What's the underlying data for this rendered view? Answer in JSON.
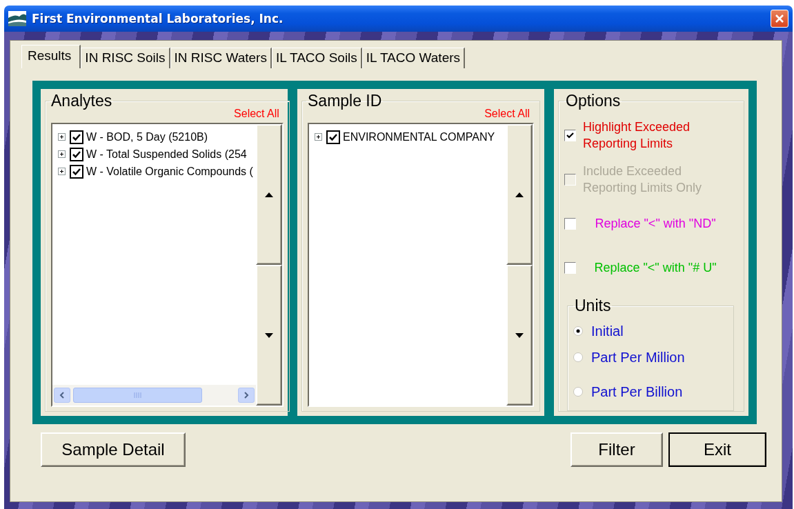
{
  "window": {
    "title": "First Environmental Laboratories, Inc."
  },
  "tabs": [
    {
      "label": "Results",
      "selected": true
    },
    {
      "label": "IN RISC Soils",
      "selected": false
    },
    {
      "label": "IN RISC Waters",
      "selected": false
    },
    {
      "label": "IL TACO Soils",
      "selected": false
    },
    {
      "label": "IL TACO Waters",
      "selected": false
    }
  ],
  "analytes": {
    "title": "Analytes",
    "select_all": "Select All",
    "items": [
      {
        "label": "W - BOD, 5 Day (5210B)",
        "checked": true,
        "expanded": false
      },
      {
        "label": "W - Total Suspended Solids (254",
        "checked": true,
        "expanded": false
      },
      {
        "label": "W - Volatile Organic Compounds (",
        "checked": true,
        "expanded": false
      }
    ]
  },
  "sample_id": {
    "title": "Sample ID",
    "select_all": "Select All",
    "items": [
      {
        "label": "ENVIRONMENTAL COMPANY",
        "checked": true,
        "expanded": false
      }
    ]
  },
  "options": {
    "title": "Options",
    "checkboxes": [
      {
        "label": "Highlight Exceeded Reporting Limits",
        "checked": true,
        "disabled": false,
        "color": "#e00000"
      },
      {
        "label": "Include Exceeded Reporting Limits Only",
        "checked": false,
        "disabled": true
      },
      {
        "label": "Replace \"<\" with \"ND\"",
        "checked": false,
        "disabled": false,
        "color": "#e000e0"
      },
      {
        "label": "Replace \"<\" with \"# U\"",
        "checked": false,
        "disabled": false,
        "color": "#00c000"
      }
    ],
    "units": {
      "title": "Units",
      "radios": [
        {
          "label": "Initial",
          "selected": true
        },
        {
          "label": "Part Per Million",
          "selected": false
        },
        {
          "label": "Part Per Billion",
          "selected": false
        }
      ]
    }
  },
  "buttons": [
    {
      "label": "Sample Detail",
      "default": false
    },
    {
      "label": "Filter",
      "default": false
    },
    {
      "label": "Exit",
      "default": true
    }
  ]
}
